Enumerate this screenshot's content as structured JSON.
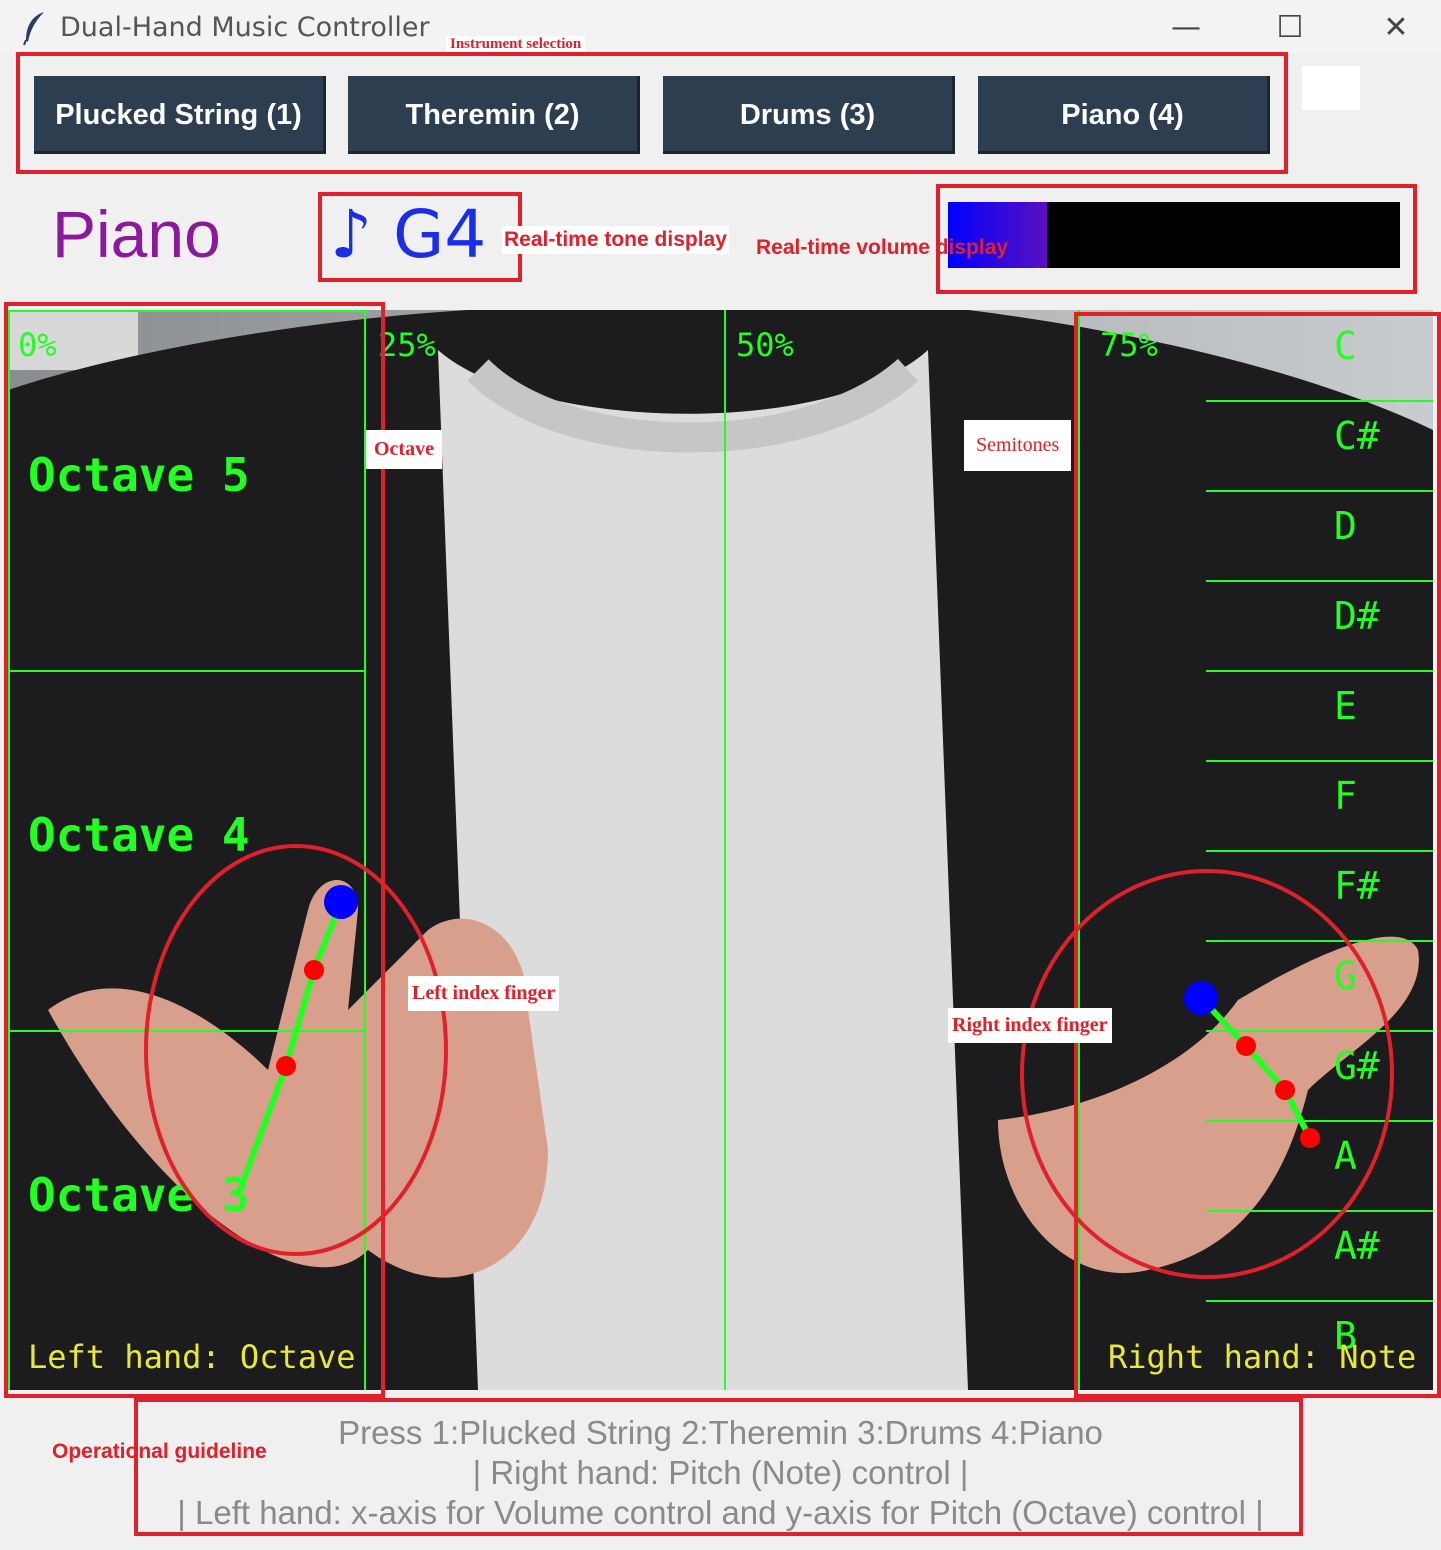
{
  "window": {
    "title": "Dual-Hand Music Controller",
    "minimize_glyph": "—",
    "maximize_glyph": "☐",
    "close_glyph": "✕"
  },
  "instruments": [
    {
      "label": "Plucked String (1)"
    },
    {
      "label": "Theremin (2)"
    },
    {
      "label": "Drums (3)"
    },
    {
      "label": "Piano (4)"
    }
  ],
  "current_instrument": "Piano",
  "current_note": "♪ G4",
  "volume": {
    "level": 0.22,
    "fill_start": "#0000ff",
    "fill_end": "#5a10c0",
    "track": "#000000"
  },
  "annotations": {
    "instrument_selection": "Instrument selection",
    "tone_display": "Real-time tone display",
    "volume_display": "Real-time volume display",
    "octave": "Octave",
    "semitones": "Semitones",
    "left_index": "Left index finger",
    "right_index": "Right index finger",
    "guideline": "Operational guideline"
  },
  "overlay": {
    "percent_labels": [
      "0%",
      "25%",
      "50%",
      "75%"
    ],
    "octaves": [
      "Octave 5",
      "Octave 4",
      "Octave 3"
    ],
    "notes": [
      "C",
      "C#",
      "D",
      "D#",
      "E",
      "F",
      "F#",
      "G",
      "G#",
      "A",
      "A#",
      "B"
    ],
    "left_hand_label": "Left hand: Octave",
    "right_hand_label": "Right hand: Note"
  },
  "guide": {
    "line1": "Press 1:Plucked String 2:Theremin 3:Drums 4:Piano",
    "line2": "| Right hand: Pitch (Note) control |",
    "line3": "| Left hand: x-axis for Volume control and y-axis for Pitch (Octave) control |"
  },
  "colors": {
    "accent_red": "#e0202a",
    "button_bg": "#2c3e50",
    "overlay_green": "#22ff22",
    "instrument_text": "#8a1a9a",
    "note_text": "#1a2ee8"
  }
}
